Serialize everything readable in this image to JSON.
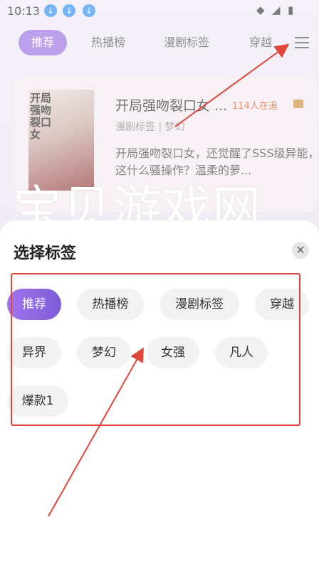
{
  "status_bar": {
    "time": "10:13"
  },
  "tabs": [
    "推荐",
    "热播榜",
    "漫剧标签",
    "穿越"
  ],
  "card": {
    "cover_title": "开局强吻裂口女",
    "title": "开局强吻裂口女 ...",
    "readers": "114人在追",
    "tags": "漫剧标签 | 梦幻",
    "description": "开局强吻裂口女，还觉醒了SSS级异能，这什么骚操作？温柔的萝..."
  },
  "watermark": "宝贝游戏网",
  "sheet": {
    "title": "选择标签",
    "chips": [
      "推荐",
      "热播榜",
      "漫剧标签",
      "穿越",
      "异界",
      "梦幻",
      "女强",
      "凡人",
      "爆款1"
    ],
    "selected": "推荐"
  },
  "colors": {
    "accent": "#9a6de0",
    "annotation": "#e0473a",
    "readers": "#d9592c"
  }
}
